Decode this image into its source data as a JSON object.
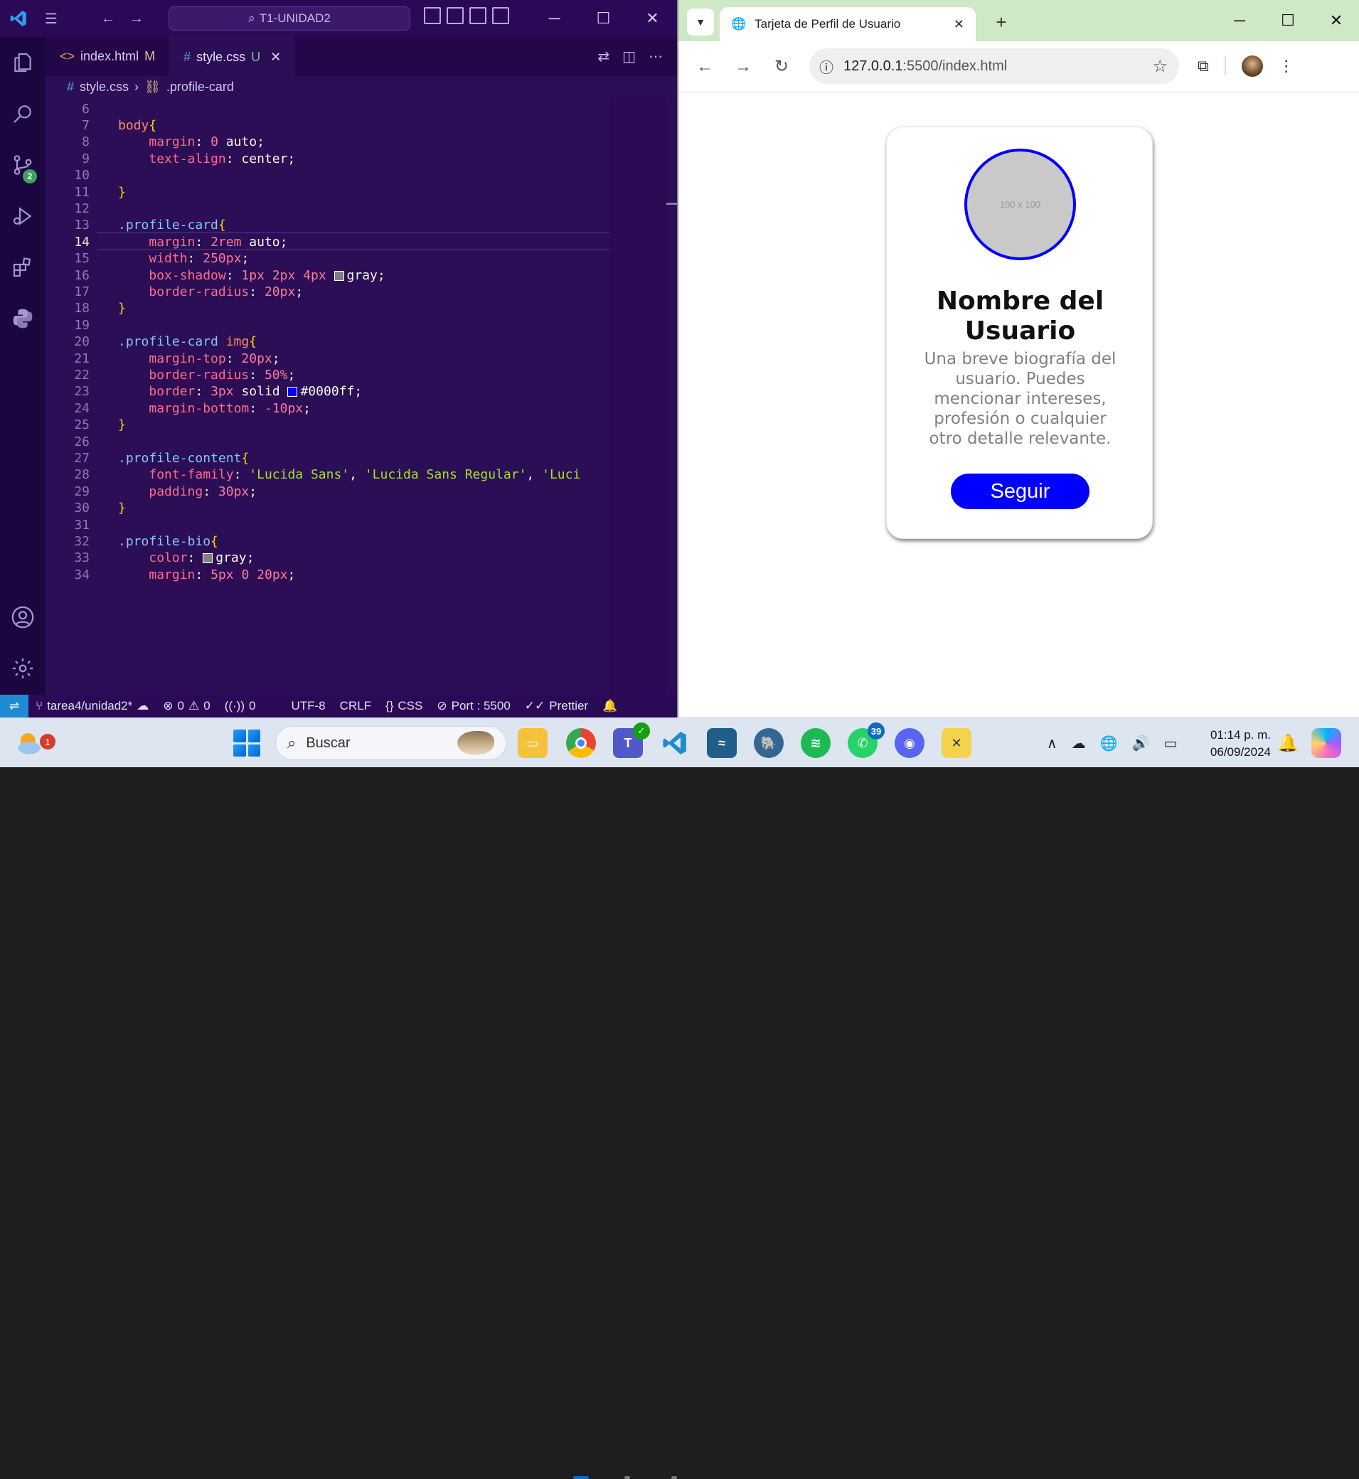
{
  "vscode": {
    "search_text": "T1-UNIDAD2",
    "tabs": [
      {
        "label": "index.html",
        "status": "M"
      },
      {
        "label": "style.css",
        "status": "U"
      }
    ],
    "breadcrumb": {
      "file": "style.css",
      "symbol": ".profile-card"
    },
    "scm_badge": "2",
    "code_lines": [
      {
        "n": "6",
        "tokens": []
      },
      {
        "n": "7",
        "tokens": [
          [
            "tag",
            "body"
          ],
          [
            "brace",
            "{"
          ]
        ]
      },
      {
        "n": "8",
        "tokens": [
          [
            "ind",
            "    "
          ],
          [
            "prop",
            "margin"
          ],
          [
            "kw",
            ": "
          ],
          [
            "num",
            "0"
          ],
          [
            "kw",
            " auto;"
          ]
        ]
      },
      {
        "n": "9",
        "tokens": [
          [
            "ind",
            "    "
          ],
          [
            "prop",
            "text-align"
          ],
          [
            "kw",
            ": center;"
          ]
        ]
      },
      {
        "n": "10",
        "tokens": []
      },
      {
        "n": "11",
        "tokens": [
          [
            "brace",
            "}"
          ]
        ]
      },
      {
        "n": "12",
        "tokens": []
      },
      {
        "n": "13",
        "tokens": [
          [
            "sel",
            ".profile-card"
          ],
          [
            "brace",
            "{"
          ]
        ]
      },
      {
        "n": "14",
        "tokens": [
          [
            "ind",
            "    "
          ],
          [
            "prop",
            "margin"
          ],
          [
            "kw",
            ": "
          ],
          [
            "num",
            "2"
          ],
          [
            "unit",
            "rem"
          ],
          [
            "kw",
            " auto;"
          ]
        ]
      },
      {
        "n": "15",
        "tokens": [
          [
            "ind",
            "    "
          ],
          [
            "prop",
            "width"
          ],
          [
            "kw",
            ": "
          ],
          [
            "num",
            "250"
          ],
          [
            "unit",
            "px"
          ],
          [
            "kw",
            ";"
          ]
        ]
      },
      {
        "n": "16",
        "tokens": [
          [
            "ind",
            "    "
          ],
          [
            "prop",
            "box-shadow"
          ],
          [
            "kw",
            ": "
          ],
          [
            "num",
            "1"
          ],
          [
            "unit",
            "px"
          ],
          [
            "kw",
            " "
          ],
          [
            "num",
            "2"
          ],
          [
            "unit",
            "px"
          ],
          [
            "kw",
            " "
          ],
          [
            "num",
            "4"
          ],
          [
            "unit",
            "px"
          ],
          [
            "kw",
            " "
          ],
          [
            "swatch",
            "#808080"
          ],
          [
            "kw",
            "gray;"
          ]
        ]
      },
      {
        "n": "17",
        "tokens": [
          [
            "ind",
            "    "
          ],
          [
            "prop",
            "border-radius"
          ],
          [
            "kw",
            ": "
          ],
          [
            "num",
            "20"
          ],
          [
            "unit",
            "px"
          ],
          [
            "kw",
            ";"
          ]
        ]
      },
      {
        "n": "18",
        "tokens": [
          [
            "brace",
            "}"
          ]
        ]
      },
      {
        "n": "19",
        "tokens": []
      },
      {
        "n": "20",
        "tokens": [
          [
            "sel",
            ".profile-card "
          ],
          [
            "tag",
            "img"
          ],
          [
            "brace",
            "{"
          ]
        ]
      },
      {
        "n": "21",
        "tokens": [
          [
            "ind",
            "    "
          ],
          [
            "prop",
            "margin-top"
          ],
          [
            "kw",
            ": "
          ],
          [
            "num",
            "20"
          ],
          [
            "unit",
            "px"
          ],
          [
            "kw",
            ";"
          ]
        ]
      },
      {
        "n": "22",
        "tokens": [
          [
            "ind",
            "    "
          ],
          [
            "prop",
            "border-radius"
          ],
          [
            "kw",
            ": "
          ],
          [
            "num",
            "50"
          ],
          [
            "unit",
            "%"
          ],
          [
            "kw",
            ";"
          ]
        ]
      },
      {
        "n": "23",
        "tokens": [
          [
            "ind",
            "    "
          ],
          [
            "prop",
            "border"
          ],
          [
            "kw",
            ": "
          ],
          [
            "num",
            "3"
          ],
          [
            "unit",
            "px"
          ],
          [
            "kw",
            " solid "
          ],
          [
            "swatch",
            "#0000ff"
          ],
          [
            "kw",
            "#0000ff;"
          ]
        ]
      },
      {
        "n": "24",
        "tokens": [
          [
            "ind",
            "    "
          ],
          [
            "prop",
            "margin-bottom"
          ],
          [
            "kw",
            ": "
          ],
          [
            "num",
            "-10"
          ],
          [
            "unit",
            "px"
          ],
          [
            "kw",
            ";"
          ]
        ]
      },
      {
        "n": "25",
        "tokens": [
          [
            "brace",
            "}"
          ]
        ]
      },
      {
        "n": "26",
        "tokens": []
      },
      {
        "n": "27",
        "tokens": [
          [
            "sel",
            ".profile-content"
          ],
          [
            "brace",
            "{"
          ]
        ]
      },
      {
        "n": "28",
        "tokens": [
          [
            "ind",
            "    "
          ],
          [
            "prop",
            "font-family"
          ],
          [
            "kw",
            ": "
          ],
          [
            "str",
            "'Lucida Sans'"
          ],
          [
            "kw",
            ", "
          ],
          [
            "str",
            "'Lucida Sans Regular'"
          ],
          [
            "kw",
            ", "
          ],
          [
            "str",
            "'Luci"
          ]
        ]
      },
      {
        "n": "29",
        "tokens": [
          [
            "ind",
            "    "
          ],
          [
            "prop",
            "padding"
          ],
          [
            "kw",
            ": "
          ],
          [
            "num",
            "30"
          ],
          [
            "unit",
            "px"
          ],
          [
            "kw",
            ";"
          ]
        ]
      },
      {
        "n": "30",
        "tokens": [
          [
            "brace",
            "}"
          ]
        ]
      },
      {
        "n": "31",
        "tokens": []
      },
      {
        "n": "32",
        "tokens": [
          [
            "sel",
            ".profile-bio"
          ],
          [
            "brace",
            "{"
          ]
        ]
      },
      {
        "n": "33",
        "tokens": [
          [
            "ind",
            "    "
          ],
          [
            "prop",
            "color"
          ],
          [
            "kw",
            ": "
          ],
          [
            "swatch",
            "#808080"
          ],
          [
            "kw",
            "gray;"
          ]
        ]
      },
      {
        "n": "34",
        "tokens": [
          [
            "ind",
            "    "
          ],
          [
            "prop",
            "margin"
          ],
          [
            "kw",
            ": "
          ],
          [
            "num",
            "5"
          ],
          [
            "unit",
            "px"
          ],
          [
            "kw",
            " "
          ],
          [
            "num",
            "0"
          ],
          [
            "kw",
            " "
          ],
          [
            "num",
            "20"
          ],
          [
            "unit",
            "px"
          ],
          [
            "kw",
            ";"
          ]
        ]
      }
    ],
    "current_line": "14",
    "status": {
      "branch": "tarea4/unidad2*",
      "errors": "0",
      "warnings": "0",
      "ports": "0",
      "encoding": "UTF-8",
      "eol": "CRLF",
      "language": "CSS",
      "port": "Port : 5500",
      "formatter": "Prettier"
    }
  },
  "chrome": {
    "tab_title": "Tarjeta de Perfil de Usuario",
    "url_host": "127.0.0.1",
    "url_rest": ":5500/index.html",
    "page": {
      "img_placeholder": "100 x 100",
      "name": "Nombre del Usuario",
      "bio": "Una breve biografía del usuario. Puedes mencionar intereses, profesión o cualquier otro detalle relevante.",
      "button": "Seguir"
    }
  },
  "taskbar": {
    "weather_badge": "1",
    "search_placeholder": "Buscar",
    "whatsapp_badge": "39",
    "time": "01:14 p. m.",
    "date": "06/09/2024"
  },
  "colors": {
    "vscode_bg": "#2b0e55",
    "chrome_tabstrip": "#cfe8c6",
    "card_border": "#0000ff",
    "button_bg": "#0000ff",
    "bio_color": "#808080"
  }
}
